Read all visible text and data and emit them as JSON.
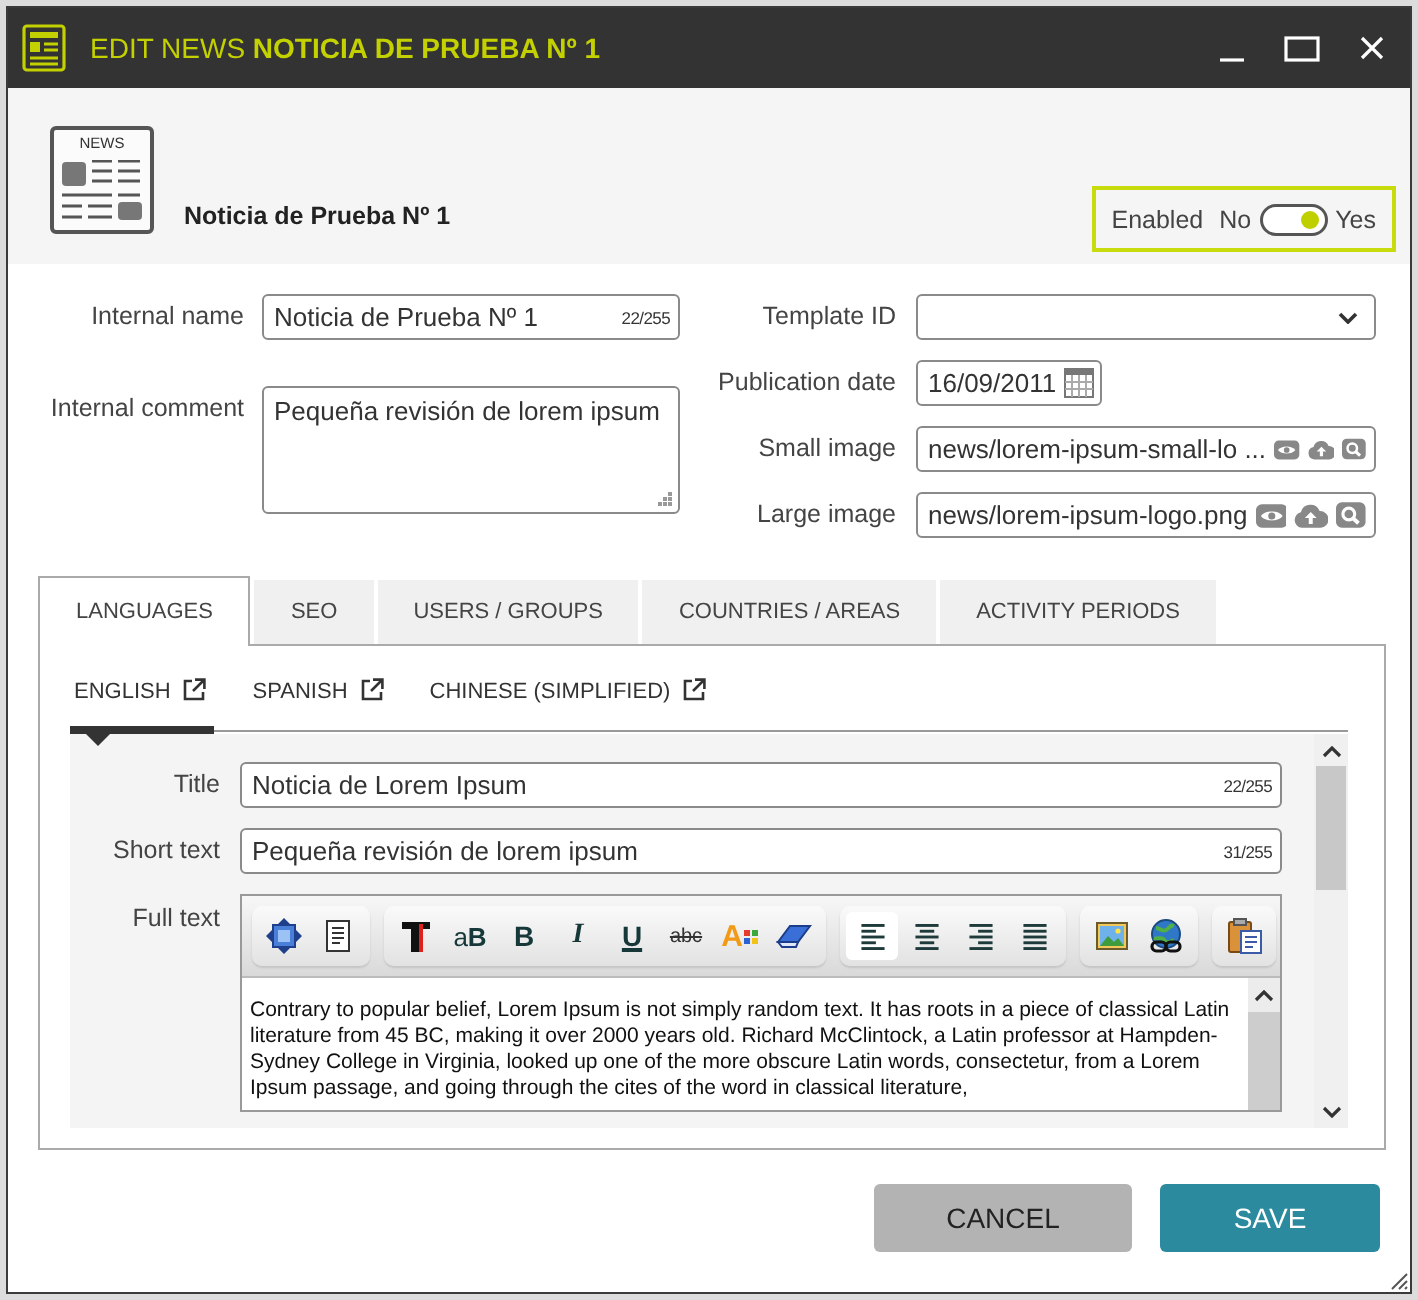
{
  "window": {
    "title": "EDIT NEWS **NOTICIA DE PRUEBA Nº 1**"
  },
  "header": {
    "icon_label": "NEWS",
    "name": "Noticia de Prueba Nº 1",
    "enabled": {
      "label": "Enabled",
      "off_label": "No",
      "on_label": "Yes",
      "on": true
    }
  },
  "form": {
    "left_column": [
      {
        "kind": "text",
        "label": "Internal name",
        "value": "Noticia de Prueba Nº 1",
        "counter": "22/255"
      },
      {
        "kind": "textarea",
        "label": "Internal comment",
        "value": "Pequeña revisión de lorem ipsum"
      }
    ],
    "right_column": [
      {
        "kind": "select",
        "label": "Template ID"
      },
      {
        "kind": "date",
        "label": "Publication date",
        "value": "16/09/2011"
      },
      {
        "kind": "file",
        "label": "Small image",
        "value": "news/lorem-ipsum-small-lo ..."
      },
      {
        "kind": "file",
        "label": "Large image",
        "value": "news/lorem-ipsum-logo.png"
      }
    ]
  },
  "tabs": [
    {
      "label": "LANGUAGES",
      "selected": true
    },
    {
      "label": "SEO",
      "selected": false
    },
    {
      "label": "USERS / GROUPS",
      "selected": false
    },
    {
      "label": "COUNTRIES / AREAS",
      "selected": false
    },
    {
      "label": "ACTIVITY PERIODS",
      "selected": false
    }
  ],
  "language_tabs": [
    {
      "label": "ENGLISH",
      "selected": true
    },
    {
      "label": "SPANISH",
      "selected": false
    },
    {
      "label": "CHINESE (SIMPLIFIED)",
      "selected": false
    }
  ],
  "language_fields": [
    {
      "kind": "text",
      "label": "Title",
      "value": "Noticia de Lorem Ipsum",
      "counter": "22/255"
    },
    {
      "kind": "text",
      "label": "Short text",
      "value": "Pequeña revisión de lorem ipsum",
      "counter": "31/255"
    },
    {
      "kind": "editor",
      "label": "Full text",
      "toolbar": [
        [
          {
            "kind": "fullscreen",
            "active": false
          },
          {
            "kind": "source",
            "active": false
          }
        ],
        [
          {
            "kind": "remove-format",
            "active": false
          },
          {
            "kind": "font-size",
            "label": "a**B**",
            "active": false
          },
          {
            "kind": "bold",
            "label": "B",
            "active": false
          },
          {
            "kind": "italic",
            "label": "I",
            "active": false
          },
          {
            "kind": "underline",
            "label": "U",
            "active": false
          },
          {
            "kind": "strikethrough",
            "label": "abc",
            "active": false
          },
          {
            "kind": "font-color",
            "label": "A",
            "active": false
          },
          {
            "kind": "eraser",
            "active": false
          }
        ],
        [
          {
            "kind": "align-left",
            "active": true
          },
          {
            "kind": "align-center",
            "active": false
          },
          {
            "kind": "align-right",
            "active": false
          },
          {
            "kind": "justify",
            "active": false
          }
        ],
        [
          {
            "kind": "image",
            "active": false
          },
          {
            "kind": "link",
            "active": false
          }
        ],
        [
          {
            "kind": "paste",
            "active": false
          }
        ]
      ],
      "content": "Contrary to popular belief, Lorem Ipsum is not simply random text. It has roots in a piece of classical Latin literature from 45 BC, making it over 2000 years old. Richard McClintock, a Latin professor at Hampden-Sydney College in Virginia, looked up one of the more obscure Latin words, consectetur, from a Lorem Ipsum passage, and going through the cites of the word in classical literature,"
    }
  ],
  "buttons": [
    {
      "kind": "secondary",
      "label": "CANCEL"
    },
    {
      "kind": "primary",
      "label": "SAVE"
    }
  ]
}
